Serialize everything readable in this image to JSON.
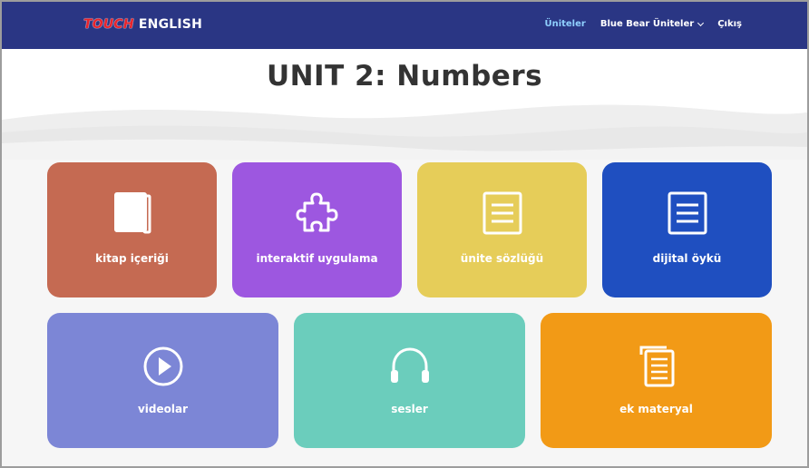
{
  "header": {
    "logo_part1": "TOUCH",
    "logo_part2": "ENGLISH",
    "nav": [
      {
        "label": "Üniteler",
        "active": true
      },
      {
        "label": "Blue Bear Üniteler",
        "dropdown": true
      },
      {
        "label": "Çıkış"
      }
    ]
  },
  "page": {
    "title": "UNIT 2: Numbers"
  },
  "cards": [
    {
      "label": "kitap içeriği",
      "icon": "book-icon",
      "color": "#c56a52"
    },
    {
      "label": "interaktif uygulama",
      "icon": "puzzle-icon",
      "color": "#9d57e0"
    },
    {
      "label": "ünite sözlüğü",
      "icon": "document-icon",
      "color": "#e6cd59"
    },
    {
      "label": "dijital öykü",
      "icon": "document-icon",
      "color": "#1f4fc0"
    },
    {
      "label": "videolar",
      "icon": "play-icon",
      "color": "#7c86d6"
    },
    {
      "label": "sesler",
      "icon": "headphones-icon",
      "color": "#6bcdbc"
    },
    {
      "label": "ek materyal",
      "icon": "copy-documents-icon",
      "color": "#f29a16"
    }
  ],
  "colors": {
    "navbar": "#2a3684",
    "active_nav": "#8fd0ff",
    "title": "#333333"
  }
}
